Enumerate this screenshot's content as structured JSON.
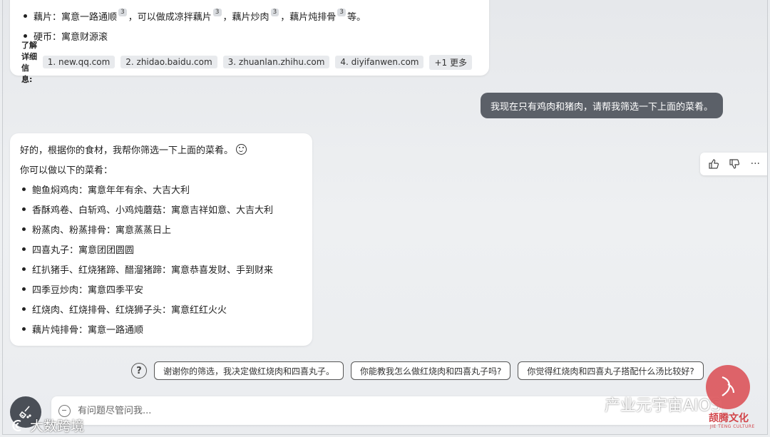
{
  "prev_message": {
    "bullets": [
      {
        "text_a": "藕片：寓意一路通顺",
        "sup1": "3",
        "text_b": "，可以做成凉拌藕片",
        "sup2": "3",
        "text_c": "，藕片炒肉",
        "sup3": "3",
        "text_d": "，藕片炖排骨",
        "sup4": "3",
        "text_e": "等。"
      },
      {
        "text": "硬币：寓意财源滚"
      }
    ],
    "refs_label": "了解详细信息:",
    "refs": [
      "1. new.qq.com",
      "2. zhidao.baidu.com",
      "3. zhuanlan.zhihu.com",
      "4. diyifanwen.com",
      "+1 更多"
    ]
  },
  "user_message": "我现在只有鸡肉和猪肉，请帮我筛选一下上面的菜肴。",
  "bot_message": {
    "intro": "好的，根据你的食材，我帮你筛选一下上面的菜肴。",
    "subtitle": "你可以做以下的菜肴：",
    "items": [
      "鲍鱼焖鸡肉：寓意年年有余、大吉大利",
      "香酥鸡卷、白斩鸡、小鸡炖蘑菇：寓意吉祥如意、大吉大利",
      "粉蒸肉、粉蒸排骨：寓意蒸蒸日上",
      "四喜丸子：寓意团团圆圆",
      "红扒猪手、红烧猪蹄、醋溜猪蹄：寓意恭喜发财、手到财来",
      "四季豆炒肉：寓意四季平安",
      "红烧肉、红烧排骨、红烧狮子头：寓意红红火火",
      "藕片炖排骨：寓意一路通顺"
    ]
  },
  "feedback": {
    "like_icon": "thumbs-up-icon",
    "dislike_icon": "thumbs-down-icon",
    "more": "···"
  },
  "suggestions": {
    "help_glyph": "?",
    "items": [
      "谢谢你的筛选，我决定做红烧肉和四喜丸子。",
      "你能教我怎么做红烧肉和四喜丸子吗?",
      "你觉得红烧肉和四喜丸子搭配什么汤比较好?"
    ]
  },
  "input": {
    "placeholder": "有问题尽管问我..."
  },
  "watermarks": {
    "left": "大数跨境",
    "right": "产业元宇宙AIOS",
    "seal_text": "颉腾文化",
    "seal_sub": "JIE TENG CULTURE"
  },
  "colors": {
    "user_bubble": "#5b6068",
    "seal": "#d2454a"
  }
}
